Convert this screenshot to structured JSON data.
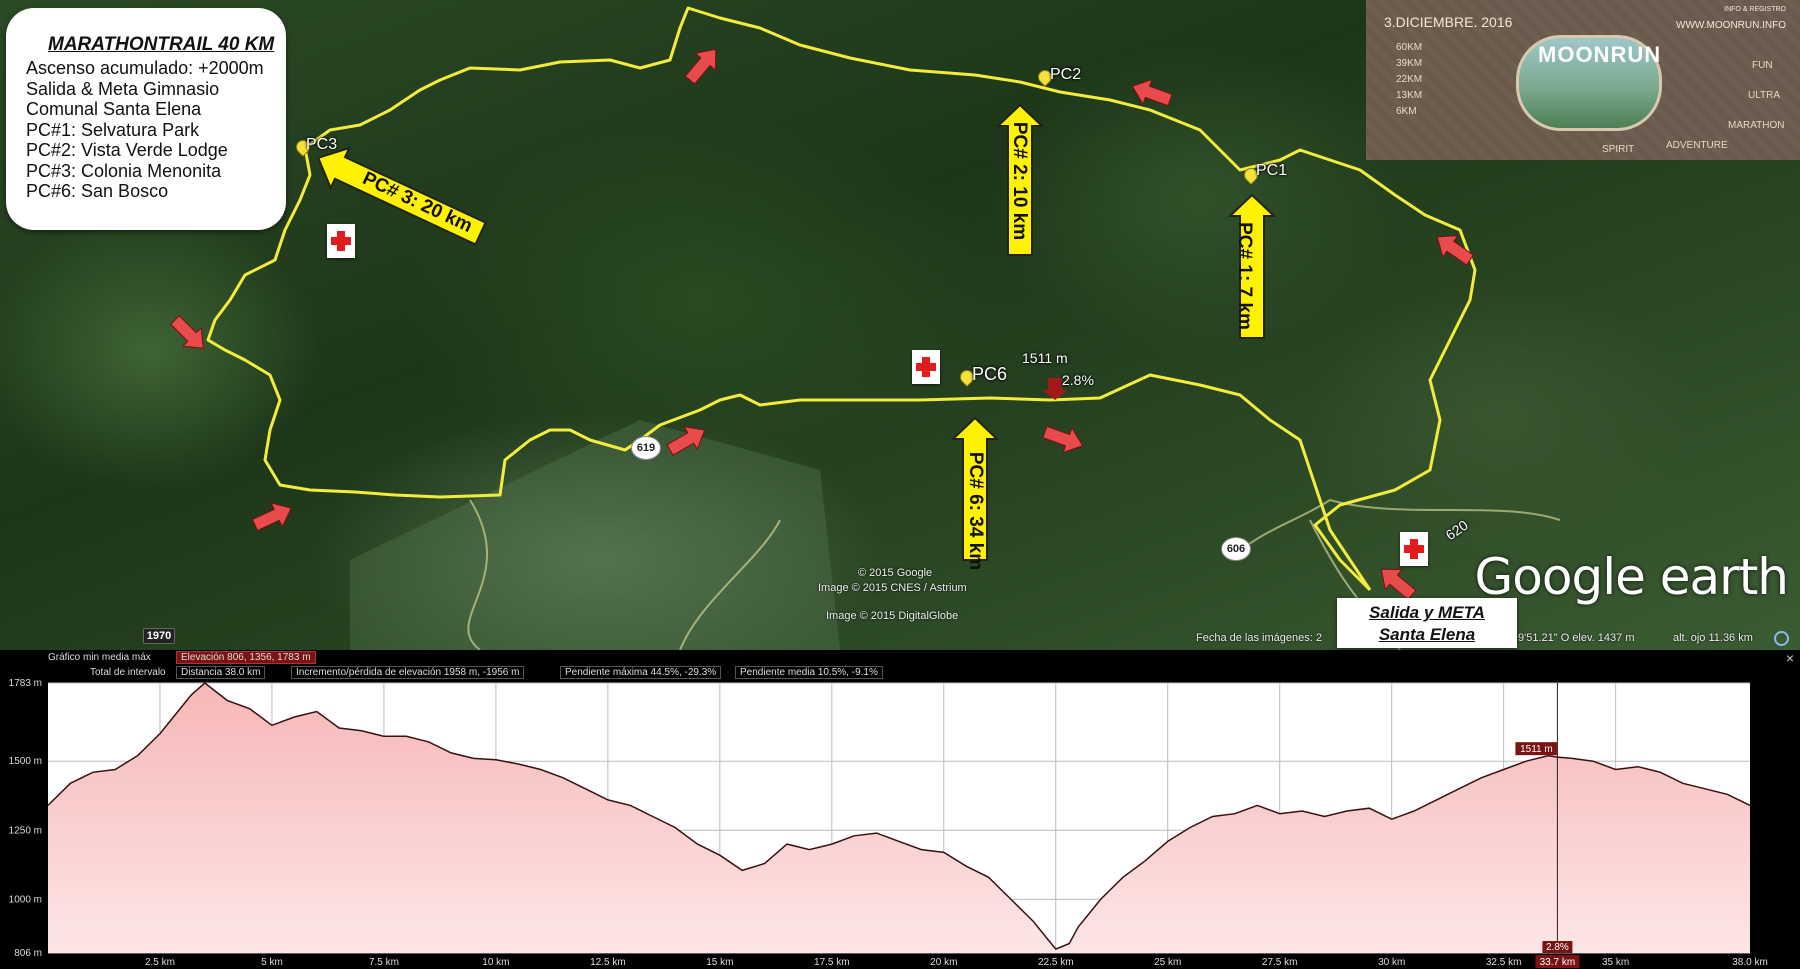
{
  "infobox": {
    "title": "MARATHONTRAIL 40 KM",
    "lines": [
      "Ascenso acumulado: +2000m",
      "Salida & Meta Gimnasio",
      "Comunal Santa Elena",
      "PC#1: Selvatura Park",
      "PC#2: Vista Verde Lodge",
      "PC#3: Colonia Menonita",
      "PC#6: San Bosco"
    ]
  },
  "checkpoints": {
    "pc1": "PC1",
    "pc2": "PC2",
    "pc3": "PC3",
    "pc6": "PC6"
  },
  "badges": {
    "pc1": "PC# 1: 7 km",
    "pc2": "PC# 2: 10 km",
    "pc3": "PC# 3: 20 km",
    "pc6": "PC# 6: 34 km"
  },
  "cursor": {
    "elevation": "1511 m",
    "grade": "2.8%"
  },
  "roads": {
    "r619": "619",
    "r606": "606",
    "r620": "620",
    "r1970": "1970"
  },
  "start_finish": {
    "line1": "Salida y META",
    "line2": "Santa Elena"
  },
  "credits": {
    "c1": "© 2015 Google",
    "c2": "Image © 2015 CNES / Astrium",
    "c3": "Image © 2015 DigitalGlobe"
  },
  "status_bar": {
    "date": "Fecha de las imágenes: 2",
    "coord": "9'51.21\" O  elev.  1437 m",
    "eye": "alt. ojo  11.36 km"
  },
  "brand": "Google earth",
  "logo": {
    "date": "3.DICIEMBRE. 2016",
    "url": "WWW.MOONRUN.INFO",
    "info": "INFO & REGISTRO",
    "name": "MOONRUN",
    "distances": [
      "60KM",
      "39KM",
      "22KM",
      "13KM",
      "6KM"
    ],
    "words": [
      "FUN",
      "ULTRA",
      "MARATHON",
      "ADVENTURE",
      "SPIRIT"
    ]
  },
  "profile": {
    "graph_label": "Gráfico  min   media  máx",
    "elevation_box": "Elevación  806, 1356, 1783 m",
    "interval_label": "Total de intervalo",
    "distance_box": "Distancia  38.0 km",
    "gain_box": "Incremento/pérdida de elevación  1958 m, -1956 m",
    "max_slope_box": "Pendiente máxima  44.5%, -29.3%",
    "avg_slope_box": "Pendiente media  10.5%, -9.1%",
    "close": "×",
    "y_labels": [
      "1783 m",
      "1500 m",
      "1250 m",
      "1000 m",
      "806 m"
    ],
    "x_labels": [
      "2.5 km",
      "5 km",
      "7.5 km",
      "10 km",
      "12.5 km",
      "15 km",
      "17.5 km",
      "20 km",
      "22.5 km",
      "25 km",
      "27.5 km",
      "30 km",
      "32.5 km",
      "33.7 km",
      "35 km",
      "38.0 km"
    ],
    "marker_elevation": "1511 m",
    "marker_grade": "2.8%"
  },
  "chart_data": {
    "type": "area",
    "xlabel": "",
    "ylabel": "",
    "xlim": [
      0,
      38.0
    ],
    "ylim": [
      806,
      1783
    ],
    "x": [
      0,
      0.5,
      1,
      1.5,
      2,
      2.5,
      3,
      3.2,
      3.5,
      4,
      4.5,
      5,
      5.5,
      6,
      6.5,
      7,
      7.5,
      8,
      8.5,
      9,
      9.5,
      10,
      10.5,
      11,
      11.5,
      12,
      12.5,
      13,
      13.5,
      14,
      14.5,
      15,
      15.5,
      16,
      16.5,
      17,
      17.5,
      18,
      18.5,
      19,
      19.5,
      20,
      20.5,
      21,
      21.5,
      22,
      22.3,
      22.5,
      22.8,
      23,
      23.5,
      24,
      24.5,
      25,
      25.5,
      26,
      26.5,
      27,
      27.5,
      28,
      28.5,
      29,
      29.5,
      30,
      30.5,
      31,
      31.5,
      32,
      32.5,
      33,
      33.5,
      33.7,
      34,
      34.5,
      35,
      35.5,
      36,
      36.5,
      37,
      37.5,
      38
    ],
    "y": [
      1340,
      1420,
      1460,
      1470,
      1520,
      1600,
      1700,
      1740,
      1783,
      1720,
      1690,
      1630,
      1660,
      1680,
      1620,
      1610,
      1590,
      1590,
      1570,
      1530,
      1510,
      1505,
      1490,
      1470,
      1440,
      1400,
      1360,
      1340,
      1300,
      1260,
      1200,
      1160,
      1105,
      1130,
      1200,
      1180,
      1200,
      1230,
      1240,
      1210,
      1180,
      1170,
      1120,
      1080,
      1000,
      920,
      860,
      820,
      840,
      900,
      1000,
      1080,
      1140,
      1210,
      1260,
      1300,
      1310,
      1340,
      1310,
      1320,
      1300,
      1320,
      1330,
      1290,
      1320,
      1360,
      1400,
      1440,
      1470,
      1500,
      1520,
      1515,
      1511,
      1500,
      1470,
      1480,
      1460,
      1420,
      1400,
      1380,
      1340
    ]
  }
}
